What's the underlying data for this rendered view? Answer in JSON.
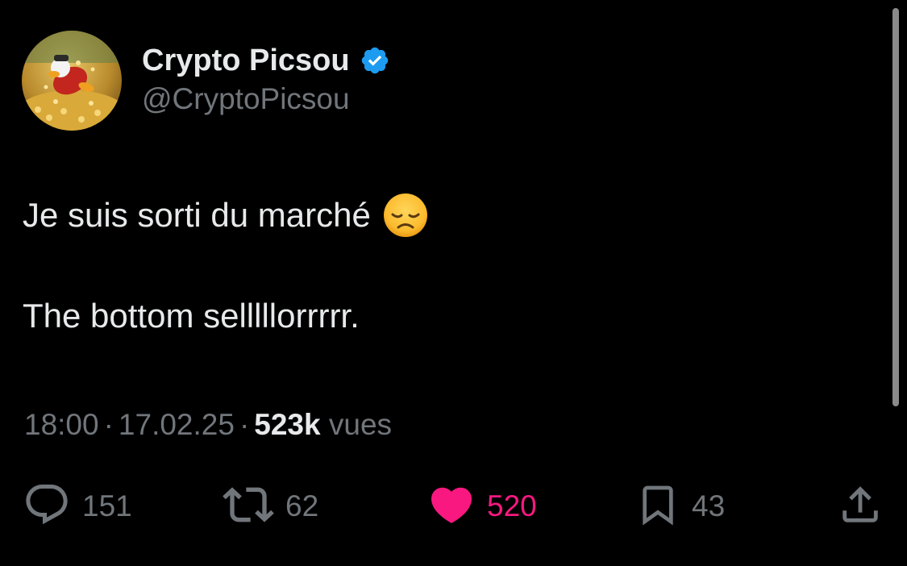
{
  "author": {
    "display_name": "Crypto Picsou",
    "handle": "@CryptoPicsou",
    "verified": true
  },
  "tweet": {
    "line1": "Je suis sorti du marché",
    "line1_emoji": "disappointed-face-emoji",
    "line2": "The bottom selllllorrrrr."
  },
  "meta": {
    "time": "18:00",
    "separator": "·",
    "date": "17.02.25",
    "views_count": "523k",
    "views_label": "vues"
  },
  "actions": {
    "reply": {
      "icon": "reply-icon",
      "count": "151"
    },
    "retweet": {
      "icon": "retweet-icon",
      "count": "62"
    },
    "like": {
      "icon": "heart-icon",
      "count": "520",
      "active": true
    },
    "bookmark": {
      "icon": "bookmark-icon",
      "count": "43"
    },
    "share": {
      "icon": "share-icon"
    }
  },
  "colors": {
    "background": "#000000",
    "primary_text": "#e7e9ea",
    "secondary_text": "#71767b",
    "like_active": "#f91880",
    "verified_badge": "#1d9bf0"
  }
}
